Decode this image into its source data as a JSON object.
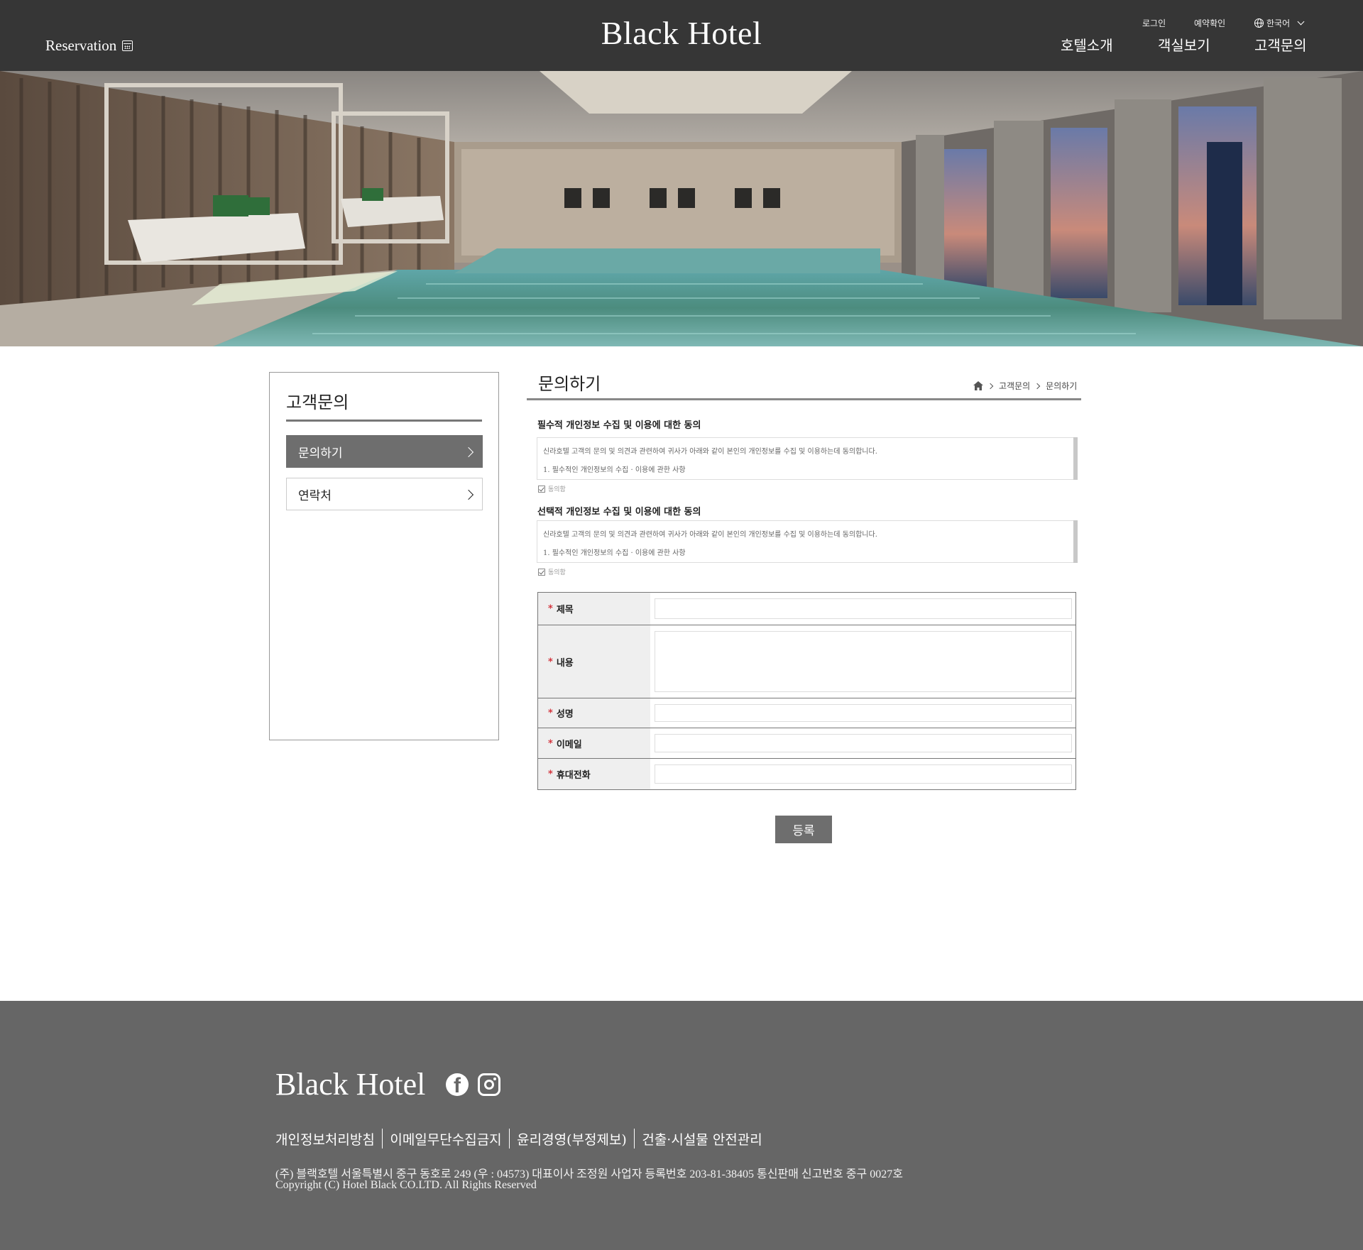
{
  "header": {
    "reservation_label": "Reservation",
    "logo": "Black Hotel",
    "util": {
      "login": "로그인",
      "reservation_check": "예약확인",
      "language": "한국어"
    },
    "nav": [
      "호텔소개",
      "객실보기",
      "고객문의"
    ]
  },
  "hero": {
    "image_desc_icon": "pool-photo"
  },
  "sidebar": {
    "title": "고객문의",
    "items": [
      {
        "label": "문의하기",
        "active": true
      },
      {
        "label": "연락처",
        "active": false
      }
    ]
  },
  "main": {
    "title": "문의하기",
    "breadcrumb": [
      "고객문의",
      "문의하기"
    ],
    "agreements": [
      {
        "heading": "필수적 개인정보 수집 및 이용에 대한 동의",
        "line1": "신라호텔 고객의 문의 및 의견과 관련하여 귀사가 아래와 같이 본인의 개인정보를 수집 및 이용하는데 동의합니다.",
        "line2": "1. 필수적인 개인정보의 수집 · 이용에 관한 사항",
        "checkbox_label": "동의함",
        "checked": true
      },
      {
        "heading": "선택적 개인정보 수집 및 이용에 대한 동의",
        "line1": "신라호텔 고객의 문의 및 의견과 관련하여 귀사가 아래와 같이 본인의 개인정보를 수집 및 이용하는데 동의합니다.",
        "line2": "1. 필수적인 개인정보의 수집 · 이용에 관한 사항",
        "checkbox_label": "동의함",
        "checked": true
      }
    ],
    "form": {
      "required_mark": "*",
      "fields": [
        {
          "label": "제목",
          "value": ""
        },
        {
          "label": "내용",
          "value": ""
        },
        {
          "label": "성명",
          "value": ""
        },
        {
          "label": "이메일",
          "value": ""
        },
        {
          "label": "휴대전화",
          "value": ""
        }
      ]
    },
    "submit_label": "등록"
  },
  "footer": {
    "logo": "Black Hotel",
    "social_icons": [
      "facebook-icon",
      "instagram-icon"
    ],
    "links": [
      "개인정보처리방침",
      "이메일무단수집금지",
      "윤리경영(부정제보)",
      "건출·시설물 안전관리"
    ],
    "address": "(주) 블랙호텔 서울특별시 중구 동호로 249 (우 : 04573) 대표이사 조정원   사업자 등록번호  203-81-38405 통신판매 신고번호 중구 0027호",
    "copyright": "Copyright (C) Hotel Black CO.LTD. All Rights Reserved"
  },
  "colors": {
    "header_bg": "#363636",
    "footer_bg": "#666666",
    "active_menu": "#6e6e6e",
    "required": "#d0202a"
  }
}
